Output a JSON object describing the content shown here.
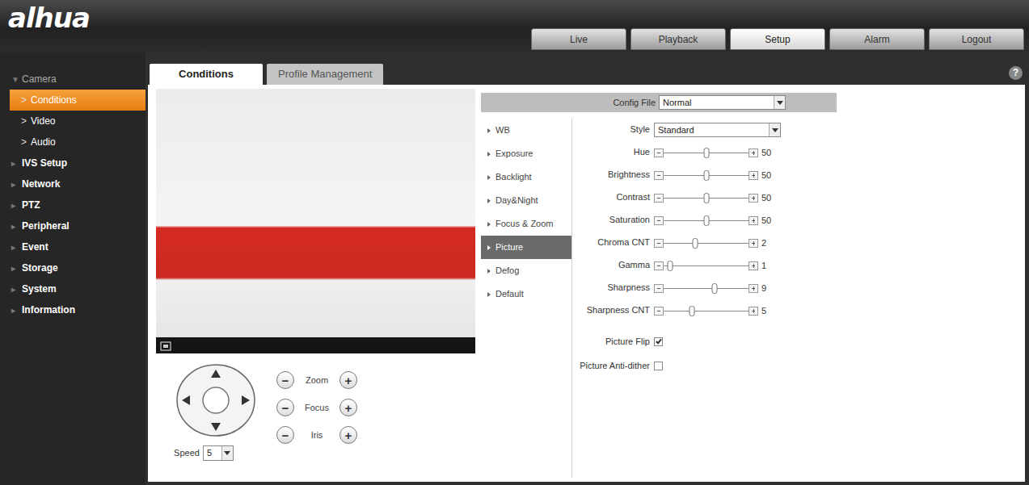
{
  "logo": {
    "text": "alhua"
  },
  "top_nav": [
    {
      "label": "Live",
      "selected": false
    },
    {
      "label": "Playback",
      "selected": false
    },
    {
      "label": "Setup",
      "selected": true
    },
    {
      "label": "Alarm",
      "selected": false
    },
    {
      "label": "Logout",
      "selected": false
    }
  ],
  "sidebar": {
    "items": [
      {
        "label": "Camera",
        "arrow": "▼",
        "kind": "group",
        "expanded": true,
        "selected": false
      },
      {
        "label": "Conditions",
        "arrow": ">",
        "kind": "sub",
        "expanded": false,
        "selected": true
      },
      {
        "label": "Video",
        "arrow": ">",
        "kind": "sub",
        "expanded": false,
        "selected": false
      },
      {
        "label": "Audio",
        "arrow": ">",
        "kind": "sub",
        "expanded": false,
        "selected": false
      },
      {
        "label": "IVS Setup",
        "arrow": "▸",
        "kind": "group",
        "expanded": false,
        "selected": false
      },
      {
        "label": "Network",
        "arrow": "▸",
        "kind": "group",
        "expanded": false,
        "selected": false
      },
      {
        "label": "PTZ",
        "arrow": "▸",
        "kind": "group",
        "expanded": false,
        "selected": false
      },
      {
        "label": "Peripheral",
        "arrow": "▸",
        "kind": "group",
        "expanded": false,
        "selected": false
      },
      {
        "label": "Event",
        "arrow": "▸",
        "kind": "group",
        "expanded": false,
        "selected": false
      },
      {
        "label": "Storage",
        "arrow": "▸",
        "kind": "group",
        "expanded": false,
        "selected": false
      },
      {
        "label": "System",
        "arrow": "▸",
        "kind": "group",
        "expanded": false,
        "selected": false
      },
      {
        "label": "Information",
        "arrow": "▸",
        "kind": "group",
        "expanded": false,
        "selected": false
      }
    ]
  },
  "page_tabs": [
    {
      "label": "Conditions",
      "selected": true
    },
    {
      "label": "Profile Management",
      "selected": false
    }
  ],
  "help": "?",
  "ptz": {
    "controls": [
      {
        "label": "Zoom",
        "minus": "−",
        "plus": "+"
      },
      {
        "label": "Focus",
        "minus": "−",
        "plus": "+"
      },
      {
        "label": "Iris",
        "minus": "−",
        "plus": "+"
      }
    ],
    "speed_label": "Speed",
    "speed_value": "5"
  },
  "config": {
    "file_label": "Config File",
    "file_value": "Normal",
    "menu": [
      {
        "label": "WB",
        "selected": false
      },
      {
        "label": "Exposure",
        "selected": false
      },
      {
        "label": "Backlight",
        "selected": false
      },
      {
        "label": "Day&Night",
        "selected": false
      },
      {
        "label": "Focus & Zoom",
        "selected": false
      },
      {
        "label": "Picture",
        "selected": true
      },
      {
        "label": "Defog",
        "selected": false
      },
      {
        "label": "Default",
        "selected": false
      }
    ],
    "settings": [
      {
        "kind": "select",
        "label": "Style",
        "value": "Standard"
      },
      {
        "kind": "slider",
        "label": "Hue",
        "value": "50",
        "level": 0.5
      },
      {
        "kind": "slider",
        "label": "Brightness",
        "value": "50",
        "level": 0.5
      },
      {
        "kind": "slider",
        "label": "Contrast",
        "value": "50",
        "level": 0.5
      },
      {
        "kind": "slider",
        "label": "Saturation",
        "value": "50",
        "level": 0.5
      },
      {
        "kind": "slider",
        "label": "Chroma CNT",
        "value": "2",
        "level": 0.37
      },
      {
        "kind": "slider",
        "label": "Gamma",
        "value": "1",
        "level": 0.08
      },
      {
        "kind": "slider",
        "label": "Sharpness",
        "value": "9",
        "level": 0.6
      },
      {
        "kind": "slider",
        "label": "Sharpness CNT",
        "value": "5",
        "level": 0.33
      },
      {
        "kind": "checkbox",
        "label": "Picture Flip",
        "checked": true
      },
      {
        "kind": "checkbox",
        "label": "Picture Anti-dither",
        "checked": false
      }
    ]
  }
}
